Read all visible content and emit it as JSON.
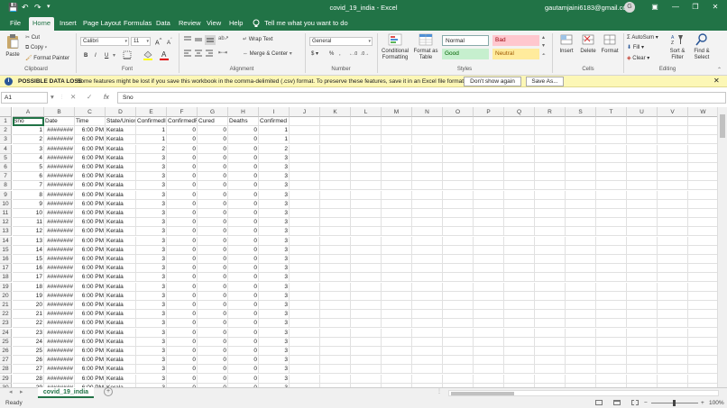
{
  "titlebar": {
    "doc_title": "covid_19_india - Excel",
    "account": "gautamjaini6183@gmail.com",
    "avatar_letter": "G",
    "save": "💾",
    "undo": "↶",
    "redo": "↷",
    "customize": "▾",
    "ribbon_display": "▣",
    "minimize": "—",
    "restore": "❐",
    "close": "✕"
  },
  "ribbon_tabs": [
    "File",
    "Home",
    "Insert",
    "Page Layout",
    "Formulas",
    "Data",
    "Review",
    "View",
    "Help"
  ],
  "tell_me": "Tell me what you want to do",
  "clipboard": {
    "paste": "Paste",
    "cut": "Cut",
    "copy": "Copy",
    "format_painter": "Format Painter",
    "label": "Clipboard"
  },
  "font": {
    "name": "Calibri",
    "size": "11",
    "grow": "A",
    "shrink": "A",
    "bold": "B",
    "italic": "I",
    "underline": "U",
    "label": "Font"
  },
  "alignment": {
    "wrap": "Wrap Text",
    "merge": "Merge & Center",
    "label": "Alignment"
  },
  "number": {
    "format": "General",
    "currency": "$",
    "percent": "%",
    "comma": ",",
    "label": "Number"
  },
  "styles": {
    "cond": "Conditional Formatting",
    "as_table": "Format as Table",
    "normal": "Normal",
    "bad": "Bad",
    "good": "Good",
    "neutral": "Neutral",
    "label": "Styles"
  },
  "cells": {
    "insert": "Insert",
    "delete": "Delete",
    "format": "Format",
    "label": "Cells"
  },
  "editing": {
    "autosum": "AutoSum",
    "fill": "Fill",
    "clear": "Clear",
    "sort": "Sort & Filter",
    "find": "Find & Select",
    "label": "Editing"
  },
  "infobar": {
    "title": "POSSIBLE DATA LOSS",
    "message": "Some features might be lost if you save this workbook in the comma-delimited (.csv) format. To preserve these features, save it in an Excel file format.",
    "dont_show": "Don't show again",
    "save_as": "Save As..."
  },
  "formula_bar": {
    "name_box": "A1",
    "cancel": "✕",
    "enter": "✓",
    "fx": "fx",
    "content": "Sno"
  },
  "columns": [
    "A",
    "B",
    "C",
    "D",
    "E",
    "F",
    "G",
    "H",
    "I",
    "J",
    "K",
    "L",
    "M",
    "N",
    "O",
    "P",
    "Q",
    "R",
    "S",
    "T",
    "U",
    "V",
    "W"
  ],
  "header_row": [
    "Sno",
    "Date",
    "Time",
    "State/UnionTerritory",
    "ConfirmedIndianNational",
    "ConfirmedForeignNational",
    "Cured",
    "Deaths",
    "Confirmed"
  ],
  "rows": [
    [
      "1",
      "########",
      "6:00 PM",
      "Kerala",
      "1",
      "0",
      "0",
      "0",
      "1"
    ],
    [
      "2",
      "########",
      "6:00 PM",
      "Kerala",
      "1",
      "0",
      "0",
      "0",
      "1"
    ],
    [
      "3",
      "########",
      "6:00 PM",
      "Kerala",
      "2",
      "0",
      "0",
      "0",
      "2"
    ],
    [
      "4",
      "########",
      "6:00 PM",
      "Kerala",
      "3",
      "0",
      "0",
      "0",
      "3"
    ],
    [
      "5",
      "########",
      "6:00 PM",
      "Kerala",
      "3",
      "0",
      "0",
      "0",
      "3"
    ],
    [
      "6",
      "########",
      "6:00 PM",
      "Kerala",
      "3",
      "0",
      "0",
      "0",
      "3"
    ],
    [
      "7",
      "########",
      "6:00 PM",
      "Kerala",
      "3",
      "0",
      "0",
      "0",
      "3"
    ],
    [
      "8",
      "########",
      "6:00 PM",
      "Kerala",
      "3",
      "0",
      "0",
      "0",
      "3"
    ],
    [
      "9",
      "########",
      "6:00 PM",
      "Kerala",
      "3",
      "0",
      "0",
      "0",
      "3"
    ],
    [
      "10",
      "########",
      "6:00 PM",
      "Kerala",
      "3",
      "0",
      "0",
      "0",
      "3"
    ],
    [
      "11",
      "########",
      "6:00 PM",
      "Kerala",
      "3",
      "0",
      "0",
      "0",
      "3"
    ],
    [
      "12",
      "########",
      "6:00 PM",
      "Kerala",
      "3",
      "0",
      "0",
      "0",
      "3"
    ],
    [
      "13",
      "########",
      "6:00 PM",
      "Kerala",
      "3",
      "0",
      "0",
      "0",
      "3"
    ],
    [
      "14",
      "########",
      "6:00 PM",
      "Kerala",
      "3",
      "0",
      "0",
      "0",
      "3"
    ],
    [
      "15",
      "########",
      "6:00 PM",
      "Kerala",
      "3",
      "0",
      "0",
      "0",
      "3"
    ],
    [
      "16",
      "########",
      "6:00 PM",
      "Kerala",
      "3",
      "0",
      "0",
      "0",
      "3"
    ],
    [
      "17",
      "########",
      "6:00 PM",
      "Kerala",
      "3",
      "0",
      "0",
      "0",
      "3"
    ],
    [
      "18",
      "########",
      "6:00 PM",
      "Kerala",
      "3",
      "0",
      "0",
      "0",
      "3"
    ],
    [
      "19",
      "########",
      "6:00 PM",
      "Kerala",
      "3",
      "0",
      "0",
      "0",
      "3"
    ],
    [
      "20",
      "########",
      "6:00 PM",
      "Kerala",
      "3",
      "0",
      "0",
      "0",
      "3"
    ],
    [
      "21",
      "########",
      "6:00 PM",
      "Kerala",
      "3",
      "0",
      "0",
      "0",
      "3"
    ],
    [
      "22",
      "########",
      "6:00 PM",
      "Kerala",
      "3",
      "0",
      "0",
      "0",
      "3"
    ],
    [
      "23",
      "########",
      "6:00 PM",
      "Kerala",
      "3",
      "0",
      "0",
      "0",
      "3"
    ],
    [
      "24",
      "########",
      "6:00 PM",
      "Kerala",
      "3",
      "0",
      "0",
      "0",
      "3"
    ],
    [
      "25",
      "########",
      "6:00 PM",
      "Kerala",
      "3",
      "0",
      "0",
      "0",
      "3"
    ],
    [
      "26",
      "########",
      "6:00 PM",
      "Kerala",
      "3",
      "0",
      "0",
      "0",
      "3"
    ],
    [
      "27",
      "########",
      "6:00 PM",
      "Kerala",
      "3",
      "0",
      "0",
      "0",
      "3"
    ],
    [
      "28",
      "########",
      "6:00 PM",
      "Kerala",
      "3",
      "0",
      "0",
      "0",
      "3"
    ],
    [
      "29",
      "########",
      "6:00 PM",
      "Kerala",
      "3",
      "0",
      "0",
      "0",
      "3"
    ]
  ],
  "sheet": {
    "tab": "covid_19_india",
    "add": "+",
    "nav_prev": "◂",
    "nav_next": "▸"
  },
  "status": {
    "ready": "Ready",
    "zoom": "100%",
    "zoom_minus": "−",
    "zoom_plus": "+"
  },
  "colors": {
    "brand": "#217346",
    "bad_bg": "#ffc7ce",
    "bad_fg": "#9c0006",
    "good_bg": "#c6efce",
    "good_fg": "#006100",
    "neutral_bg": "#ffeb9c",
    "neutral_fg": "#9c5700",
    "info_bar": "#fcf7b6"
  }
}
